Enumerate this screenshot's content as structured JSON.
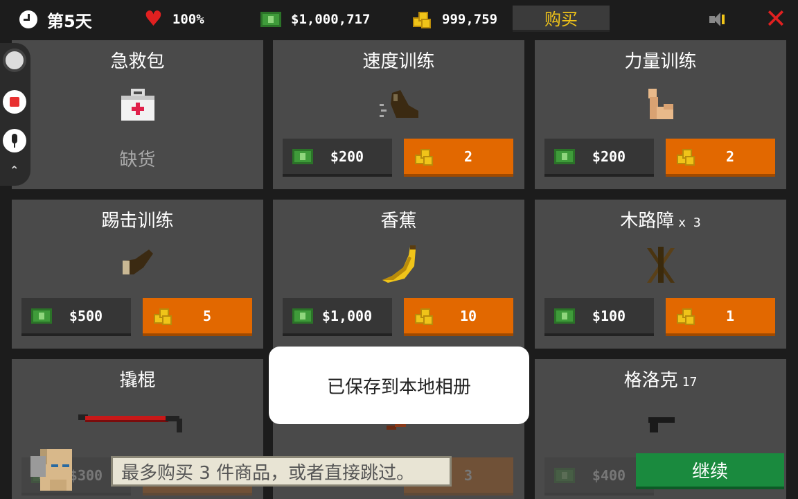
{
  "topbar": {
    "day_label": "第5天",
    "health": "100%",
    "money": "$1,000,717",
    "gold": "999,759",
    "buy_label": "购买"
  },
  "cards": [
    {
      "title": "急救包",
      "qty": "",
      "status": "缺货",
      "money": "",
      "gold": ""
    },
    {
      "title": "速度训练",
      "qty": "",
      "status": "",
      "money": "$200",
      "gold": "2"
    },
    {
      "title": "力量训练",
      "qty": "",
      "status": "",
      "money": "$200",
      "gold": "2"
    },
    {
      "title": "踢击训练",
      "qty": "",
      "status": "",
      "money": "$500",
      "gold": "5"
    },
    {
      "title": "香蕉",
      "qty": "",
      "status": "",
      "money": "$1,000",
      "gold": "10"
    },
    {
      "title": "木路障",
      "qty": "x 3",
      "status": "",
      "money": "$100",
      "gold": "1"
    },
    {
      "title": "撬棍",
      "qty": "",
      "status": "",
      "money": "$300",
      "gold": ""
    },
    {
      "title": "",
      "qty": "",
      "status": "",
      "money": "",
      "gold": "3"
    },
    {
      "title": "格洛克",
      "qty": "17",
      "status": "",
      "money": "$400",
      "gold": ""
    }
  ],
  "toast": "已保存到本地相册",
  "dialog": {
    "text": "最多购买 3 件商品，或者直接跳过。",
    "continue_label": "继续"
  },
  "colors": {
    "card_bg": "#4a4a4a",
    "gold_button": "#e26800",
    "money_button": "#363636",
    "continue_button": "#1a8a3e",
    "accent_gold": "#f0c419",
    "danger_red": "#e02020"
  }
}
